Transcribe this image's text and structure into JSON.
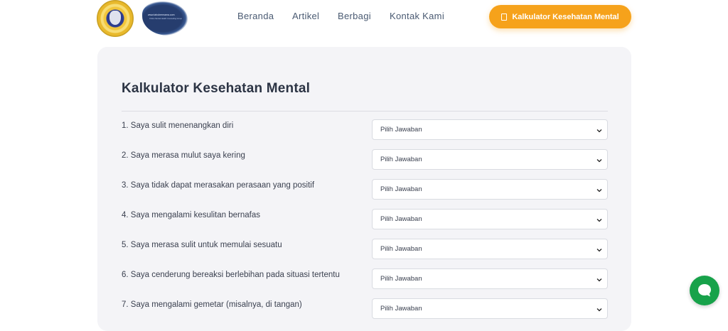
{
  "header": {
    "brand_text": "www.tahubermama.com",
    "brand_sub": "Online Mental Health Counseling Group",
    "nav": [
      {
        "label": "Beranda"
      },
      {
        "label": "Artikel"
      },
      {
        "label": "Berbagi"
      },
      {
        "label": "Kontak Kami"
      }
    ],
    "cta_label": "Kalkulator Kesehatan Mental",
    "cta_color": "#f6a21b"
  },
  "main": {
    "title": "Kalkulator Kesehatan Mental",
    "questions": [
      {
        "label": "1. Saya sulit menenangkan diri",
        "select_value": "Pilih Jawaban"
      },
      {
        "label": "2. Saya merasa mulut saya kering",
        "select_value": "Pilih Jawaban"
      },
      {
        "label": "3. Saya tidak dapat merasakan perasaan yang positif",
        "select_value": "Pilih Jawaban"
      },
      {
        "label": "4. Saya mengalami kesulitan bernafas",
        "select_value": "Pilih Jawaban"
      },
      {
        "label": "5. Saya merasa sulit untuk memulai sesuatu",
        "select_value": "Pilih Jawaban"
      },
      {
        "label": "6. Saya cenderung bereaksi berlebihan pada situasi tertentu",
        "select_value": "Pilih Jawaban"
      },
      {
        "label": "7. Saya mengalami gemetar (misalnya, di tangan)",
        "select_value": "Pilih Jawaban"
      }
    ]
  },
  "chat": {
    "icon": "chat-bubble-icon",
    "color": "#17a24a"
  }
}
